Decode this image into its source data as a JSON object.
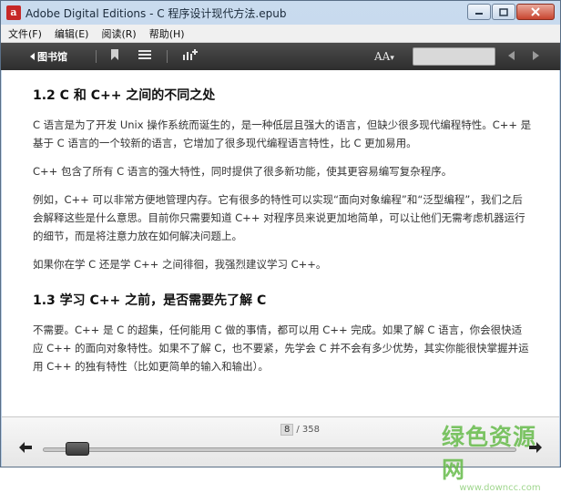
{
  "window": {
    "title": "Adobe Digital Editions - C  程序设计现代方法.epub",
    "icon_letter": "a",
    "controls": [
      "minimize-icon",
      "maximize-icon",
      "close-icon"
    ]
  },
  "menu": {
    "items": [
      "文件(F)",
      "编辑(E)",
      "阅读(R)",
      "帮助(H)"
    ]
  },
  "toolbar": {
    "library_label": "图书馆",
    "font_size_label": "AA",
    "icons": [
      "back-arrow-icon",
      "bookmark-icon",
      "list-icon",
      "chart-add-icon",
      "font-size-icon",
      "prev-arrow-icon",
      "next-arrow-icon"
    ],
    "search_placeholder": ""
  },
  "content": {
    "section1_title": "1.2  C 和 C++ 之间的不同之处",
    "p1": "C 语言是为了开发 Unix 操作系统而诞生的，是一种低层且强大的语言，但缺少很多现代编程特性。C++ 是基于 C 语言的一个较新的语言，它增加了很多现代编程语言特性，比 C 更加易用。",
    "p2": "C++ 包含了所有 C 语言的强大特性，同时提供了很多新功能，使其更容易编写复杂程序。",
    "p3": "例如，C++ 可以非常方便地管理内存。它有很多的特性可以实现“面向对象编程”和“泛型编程”，我们之后会解释这些是什么意思。目前你只需要知道 C++ 对程序员来说更加地简单，可以让他们无需考虑机器运行的细节，而是将注意力放在如何解决问题上。",
    "p4": "如果你在学 C 还是学 C++ 之间徘徊，我强烈建议学习 C++。",
    "section2_title": "1.3  学习 C++ 之前，是否需要先了解 C",
    "p5": "不需要。C++ 是 C 的超集，任何能用 C 做的事情，都可以用 C++ 完成。如果了解 C 语言，你会很快适应 C++ 的面向对象特性。如果不了解 C，也不要紧，先学会 C 并不会有多少优势，其实你能很快掌握并运用 C++ 的独有特性（比如更简单的输入和输出）。"
  },
  "footer": {
    "current_page": "8",
    "total_pages": "/ 358",
    "progress": 0.022
  },
  "watermark": {
    "text": "绿色资源网",
    "url": "www.downcc.com"
  }
}
